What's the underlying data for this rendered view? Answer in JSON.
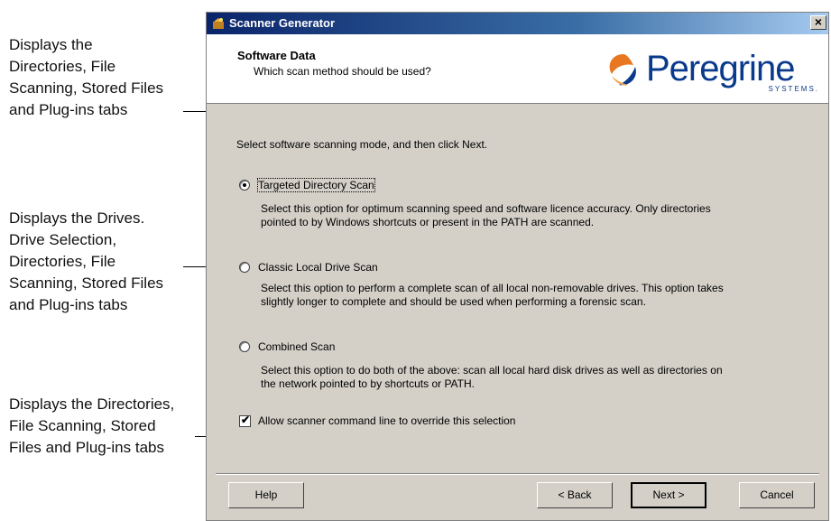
{
  "annotations": {
    "targeted": [
      "Displays the",
      "Directories, File",
      "Scanning, Stored Files",
      "and Plug-ins tabs"
    ],
    "classic": [
      "Displays the Drives.",
      "Drive Selection,",
      "Directories, File",
      "Scanning, Stored Files",
      "and Plug-ins tabs"
    ],
    "combined": [
      "Displays the Directories,",
      "File Scanning, Stored",
      "Files and Plug-ins tabs"
    ]
  },
  "window": {
    "title": "Scanner Generator",
    "close_glyph": "×"
  },
  "header": {
    "title": "Software Data",
    "subtitle": "Which scan method should be used?",
    "logo_text": "Peregrine",
    "logo_sub": "SYSTEMS."
  },
  "main": {
    "instruction": "Select software scanning mode, and then click Next.",
    "options": [
      {
        "label": "Targeted Directory Scan",
        "checked": true,
        "description": "Select this option for optimum scanning speed and software licence accuracy. Only directories pointed to by Windows shortcuts or present in the PATH are scanned."
      },
      {
        "label": "Classic Local Drive Scan",
        "checked": false,
        "description": "Select this option to perform a complete scan of all local non-removable drives. This option takes slightly longer to complete and should be used when performing a forensic scan."
      },
      {
        "label": "Combined Scan",
        "checked": false,
        "description": "Select this option to do both of the above: scan all local hard disk drives as well as directories on the network pointed to by shortcuts or PATH."
      }
    ],
    "override_checkbox": {
      "label": "Allow scanner command line to override this selection",
      "checked": true
    }
  },
  "buttons": {
    "help": "Help",
    "back": "< Back",
    "next": "Next >",
    "cancel": "Cancel"
  }
}
